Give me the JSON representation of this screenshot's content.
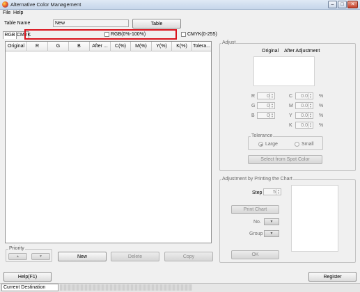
{
  "window": {
    "title": "Alternative Color Management",
    "min": "–",
    "max": "□",
    "close": "✕"
  },
  "menu": {
    "file": "File",
    "help": "Help"
  },
  "header": {
    "table_name_label": "Table Name",
    "table_name_value": "New",
    "table_button": "Table"
  },
  "tabs": {
    "rgb": "RGB",
    "cmyk": "CMYK"
  },
  "options": {
    "rgb_percent": "RGB(0%-100%)",
    "cmyk_255": "CMYK(0-255)"
  },
  "grid": {
    "columns": [
      "Original",
      "R",
      "G",
      "B",
      "After ...",
      "C(%)",
      "M(%)",
      "Y(%)",
      "K(%)",
      "Tolera..."
    ],
    "rows": []
  },
  "priority": {
    "label": "Priority",
    "up": "▲",
    "down": "▼"
  },
  "actions": {
    "new": "New",
    "delete": "Delete",
    "copy": "Copy"
  },
  "adjust": {
    "label": "Adjust",
    "col_original": "Original",
    "col_after": "After Adjustment",
    "rgb": [
      {
        "label": "R",
        "value": "0"
      },
      {
        "label": "G",
        "value": "0"
      },
      {
        "label": "B",
        "value": "0"
      }
    ],
    "cmyk": [
      {
        "label": "C",
        "value": "0.0"
      },
      {
        "label": "M",
        "value": "0.0"
      },
      {
        "label": "Y",
        "value": "0.0"
      },
      {
        "label": "K",
        "value": "0.0"
      }
    ],
    "pct": "%",
    "tolerance": {
      "label": "Tolerance",
      "large": "Large",
      "small": "Small",
      "selected": "Large"
    },
    "select_spot": "Select from Spot Color"
  },
  "print_chart": {
    "label": "Adjustment by Printing the Chart",
    "step_label": "Step",
    "step_value": "5",
    "print_button": "Print Chart",
    "no_label": "No.",
    "group_label": "Group",
    "ok": "OK"
  },
  "bottom": {
    "help": "Help(F1)",
    "register": "Register",
    "status_label": "Current Destination"
  }
}
